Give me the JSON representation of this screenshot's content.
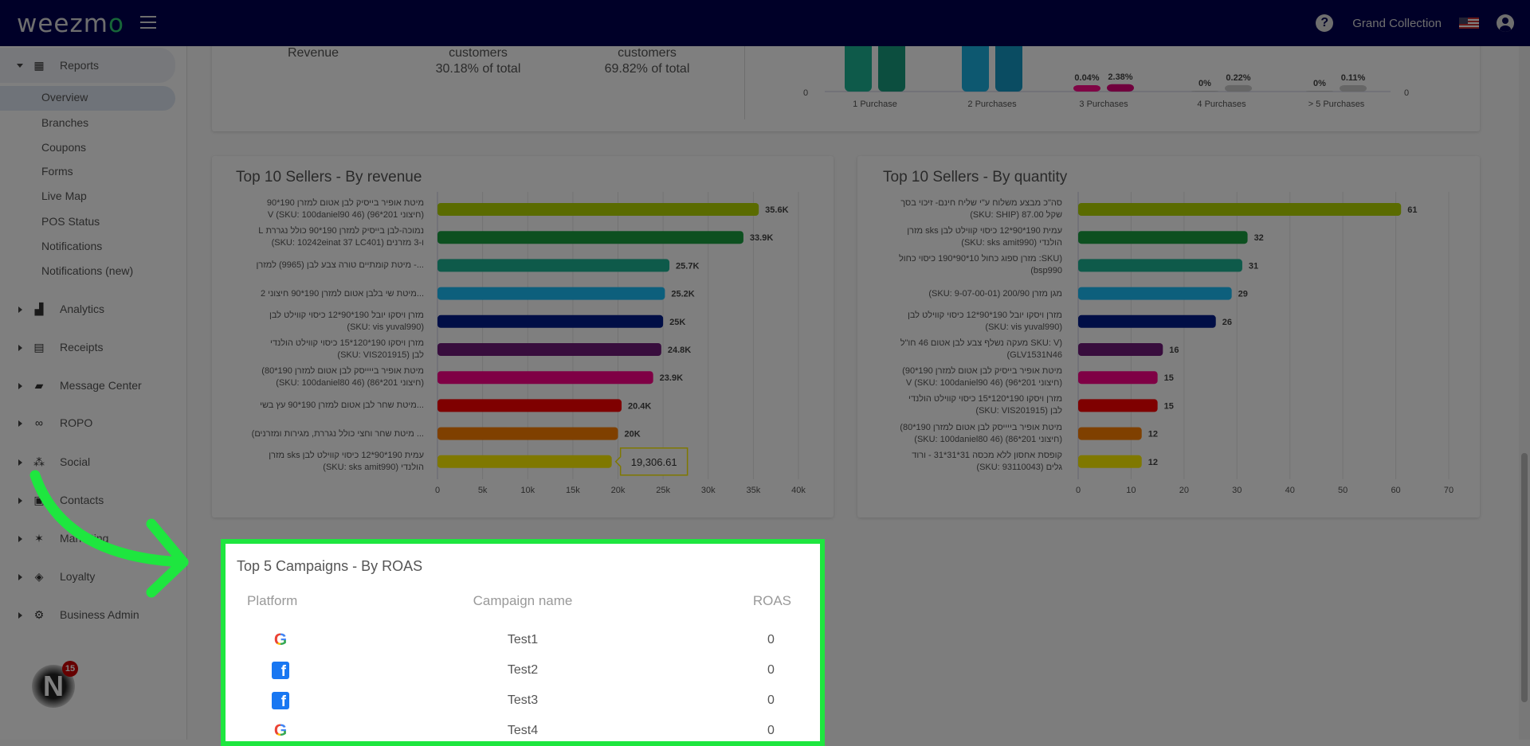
{
  "header": {
    "logo": "weezmo",
    "brand": "Grand Collection",
    "help_icon": "help-circle-icon",
    "flag_icon": "us-flag-icon",
    "user_icon": "account-icon"
  },
  "sidebar": {
    "group_open": {
      "label": "Reports",
      "icon": "dashboard-icon"
    },
    "sub_items": [
      "Overview",
      "Branches",
      "Coupons",
      "Forms",
      "Live Map",
      "POS Status",
      "Notifications",
      "Notifications (new)"
    ],
    "active_sub": "Overview",
    "groups": [
      {
        "label": "Analytics",
        "icon": "analytics-icon"
      },
      {
        "label": "Receipts",
        "icon": "receipt-icon"
      },
      {
        "label": "Message Center",
        "icon": "message-icon"
      },
      {
        "label": "ROPO",
        "icon": "infinity-icon"
      },
      {
        "label": "Social",
        "icon": "people-icon"
      },
      {
        "label": "Contacts",
        "icon": "contacts-icon"
      },
      {
        "label": "Marketing",
        "icon": "party-popper-icon"
      },
      {
        "label": "Loyalty",
        "icon": "tag-icon"
      },
      {
        "label": "Business Admin",
        "icon": "gear-icon"
      }
    ],
    "avatar_badge": "15"
  },
  "top_card": {
    "stats": [
      {
        "label": "Revenue",
        "sub": ""
      },
      {
        "label": "customers",
        "sub": "30.18% of total"
      },
      {
        "label": "customers",
        "sub": "69.82% of total"
      }
    ]
  },
  "chart_data": [
    {
      "type": "bar",
      "categories": [
        "1 Purchase",
        "2 Purchases",
        "3 Purchases",
        "4 Purchases",
        "> 5 Purchases"
      ],
      "series": [
        {
          "values": [
            null,
            null,
            0.04,
            0,
            0
          ]
        },
        {
          "values": [
            null,
            null,
            2.38,
            0.22,
            0.11
          ]
        }
      ],
      "data_labels": [
        [
          "",
          ""
        ],
        [
          "",
          ""
        ],
        [
          "0.04%",
          "2.38%"
        ],
        [
          "0%",
          "0.22%"
        ],
        [
          "0%",
          "0.11%"
        ]
      ],
      "y_tick_left": "0",
      "y_tick_right": "0",
      "colors": [
        [
          "#1cb494",
          "#189c7e"
        ],
        [
          "#1ab0e0",
          "#1598c4"
        ],
        [
          "#ff0a8a",
          "#e0007a"
        ],
        [
          "#cccccc",
          "#cccccc"
        ],
        [
          "#cccccc",
          "#cccccc"
        ]
      ]
    },
    {
      "type": "bar",
      "orientation": "horizontal",
      "title": "Top 10 Sellers - By revenue",
      "categories": [
        "מיטת אופיר בייסיק לבן אטום למזרן 190*90\n(חיצוני 201*96) V (SKU: 100daniel90 46)",
        "נמוכה-לבן בייסיק למזרן 190*90 כולל נגררת L\nו-3 מזרנים (SKU: 10242einat 37 LC401)",
        "...- מיטת קומתיים טורה צבע לבן (9965) למזרן",
        "...מיטת שי בלבן אטום למזרן 190*90 חיצוני 2",
        "מזרן ויסקו יובל 190*90*12 כיסוי קווילט לבן\n(SKU: vis yuval990)",
        "מזרן ויסקו 190*120*15 כיסוי קווילט הולנדי\nלבן (SKU: VIS201915)",
        "מיטת אופיר בייייסק לבן אטום למזרן 190*80)\n(חיצוני 201*86) (SKU: 100daniel80 46)",
        "...מיטת שחר לבן אטום למזרן 190*90 עץ בשי",
        "... מיטת שחר וחצי כולל נגררת, מגירות ומזרנים)",
        "עמית 190*90*12 כיסוי קווילט לבן sks מזרן\nהולנדי (SKU: sks amit990)"
      ],
      "values": [
        35600,
        33900,
        25700,
        25200,
        25000,
        24800,
        23900,
        20400,
        20000,
        19306.61
      ],
      "data_labels": [
        "35.6K",
        "33.9K",
        "25.7K",
        "25.2K",
        "25K",
        "24.8K",
        "23.9K",
        "20.4K",
        "20K",
        "19.3K"
      ],
      "tooltip": "19,306.61",
      "xlim": [
        0,
        40000
      ],
      "x_ticks": [
        "0",
        "5k",
        "10k",
        "15k",
        "20k",
        "25k",
        "30k",
        "35k",
        "40k"
      ],
      "grid": true,
      "colors": [
        "#b4d600",
        "#1aa040",
        "#1cb494",
        "#1abef8",
        "#001c8c",
        "#701a7a",
        "#ff008a",
        "#ff0000",
        "#ff8000",
        "#fff000"
      ]
    },
    {
      "type": "bar",
      "orientation": "horizontal",
      "title": "Top 10 Sellers - By quantity",
      "categories": [
        "סה\"כ מבצע משלוח ע\"י שליח חינם- זיכוי בסך\nשקל 87.00 (SKU: SHIP)",
        "עמית 190*90*12 כיסוי קווילט לבן sks מזרן\nהולנדי (SKU: sks amit990)",
        "(SKU: מזרן ספוג כחול 10*90*190 כיסוי כחול\nbsp990)",
        "מגן מזרן 200/90 (SKU: 9-07-00-01)",
        "מזרן ויסקו יובל 190*90*12 כיסוי קווילט לבן\n(SKU: vis yuval990)",
        "(SKU: V מעקה נשלף צבע לבן אטום 46 חו\"ל\nGLV1531N46)",
        "מיטת אופיר בייסיק לבן אטום למזרן 190*90)\n(חיצוני 201*96) V (SKU: 100daniel90 46)",
        "מזרן ויסקו 190*120*15 כיסוי קווילט הולנדי\nלבן (SKU: VIS201915)",
        "מיטת אופיר בייייסק לבן אטום למזרן 190*80)\n(חיצוני 201*86) (SKU: 100daniel80 46)",
        "קופסת אחסון ללא מכסה 31*31*31 - ורוד\nגלים (SKU: 93110043)"
      ],
      "values": [
        61,
        32,
        31,
        29,
        26,
        16,
        15,
        15,
        12,
        12
      ],
      "data_labels": [
        "61",
        "32",
        "31",
        "29",
        "26",
        "16",
        "15",
        "15",
        "12",
        "12"
      ],
      "xlim": [
        0,
        70
      ],
      "x_ticks": [
        "0",
        "10",
        "20",
        "30",
        "40",
        "50",
        "60",
        "70"
      ],
      "grid": true,
      "colors": [
        "#b4d600",
        "#1aa040",
        "#1cb494",
        "#1abef8",
        "#001c8c",
        "#701a7a",
        "#ff008a",
        "#ff0000",
        "#ff8000",
        "#fff000"
      ]
    }
  ],
  "campaigns": {
    "title": "Top 5 Campaigns - By ROAS",
    "columns": [
      "Platform",
      "Campaign name",
      "ROAS"
    ],
    "rows": [
      {
        "platform": "google-icon",
        "name": "Test1",
        "roas": "0"
      },
      {
        "platform": "facebook-icon",
        "name": "Test2",
        "roas": "0"
      },
      {
        "platform": "facebook-icon",
        "name": "Test3",
        "roas": "0"
      },
      {
        "platform": "google-icon",
        "name": "Test4",
        "roas": "0"
      }
    ],
    "highlight_color": "#1ee63f"
  }
}
